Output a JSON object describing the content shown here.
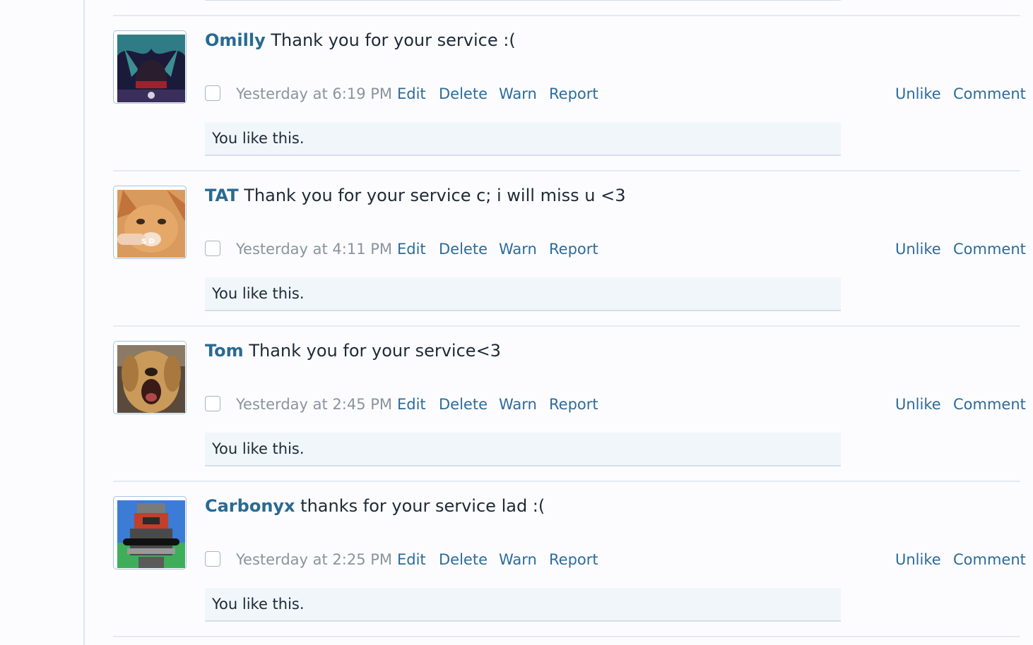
{
  "posts": [
    {
      "author": "Omilly",
      "message": "Thank you for your service :(",
      "time": "Yesterday at 6:19 PM",
      "actions": {
        "edit": "Edit",
        "delete": "Delete",
        "warn": "Warn",
        "report": "Report",
        "unlike": "Unlike",
        "comment": "Comment"
      },
      "likes": "You like this."
    },
    {
      "author": "TAT",
      "message": "Thank you for your service c; i will miss u <3",
      "time": "Yesterday at 4:11 PM",
      "actions": {
        "edit": "Edit",
        "delete": "Delete",
        "warn": "Warn",
        "report": "Report",
        "unlike": "Unlike",
        "comment": "Comment"
      },
      "likes": "You like this."
    },
    {
      "author": "Tom",
      "message": "Thank you for your service<3",
      "time": "Yesterday at 2:45 PM",
      "actions": {
        "edit": "Edit",
        "delete": "Delete",
        "warn": "Warn",
        "report": "Report",
        "unlike": "Unlike",
        "comment": "Comment"
      },
      "likes": "You like this."
    },
    {
      "author": "Carbonyx",
      "message": "thanks for your service lad :(",
      "time": "Yesterday at 2:25 PM",
      "actions": {
        "edit": "Edit",
        "delete": "Delete",
        "warn": "Warn",
        "report": "Report",
        "unlike": "Unlike",
        "comment": "Comment"
      },
      "likes": "You like this."
    }
  ],
  "colors": {
    "link": "#2d6b9a",
    "author": "#2a6a92",
    "muted": "#8a949c",
    "like_bg": "#f1f6fb"
  }
}
